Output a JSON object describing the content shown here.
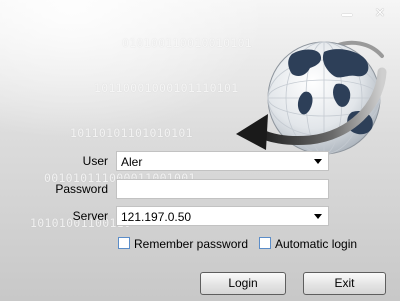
{
  "window": {
    "controls": [
      {
        "name": "minimize-button",
        "icon": "minimize-icon"
      },
      {
        "name": "close-button",
        "icon": "close-icon",
        "glyph": "✕"
      }
    ]
  },
  "background": {
    "binary_lines": [
      "010100110010010101",
      "10110001000101110101",
      "10110101101010101",
      "001010111000011001001",
      "10101001100110"
    ]
  },
  "logo": {
    "icon": "globe-arrow-icon"
  },
  "form": {
    "user": {
      "label": "User",
      "value": "Aler"
    },
    "password": {
      "label": "Password",
      "value": ""
    },
    "server": {
      "label": "Server",
      "value": "121.197.0.50"
    }
  },
  "options": {
    "remember": {
      "label": "Remember password",
      "checked": false
    },
    "auto_login": {
      "label": "Automatic login",
      "checked": false
    }
  },
  "buttons": {
    "login": "Login",
    "exit": "Exit"
  },
  "colors": {
    "checkbox_border": "#5b8dc9",
    "globe_land": "#2d3f58",
    "arrow": "#3a3a3a"
  }
}
